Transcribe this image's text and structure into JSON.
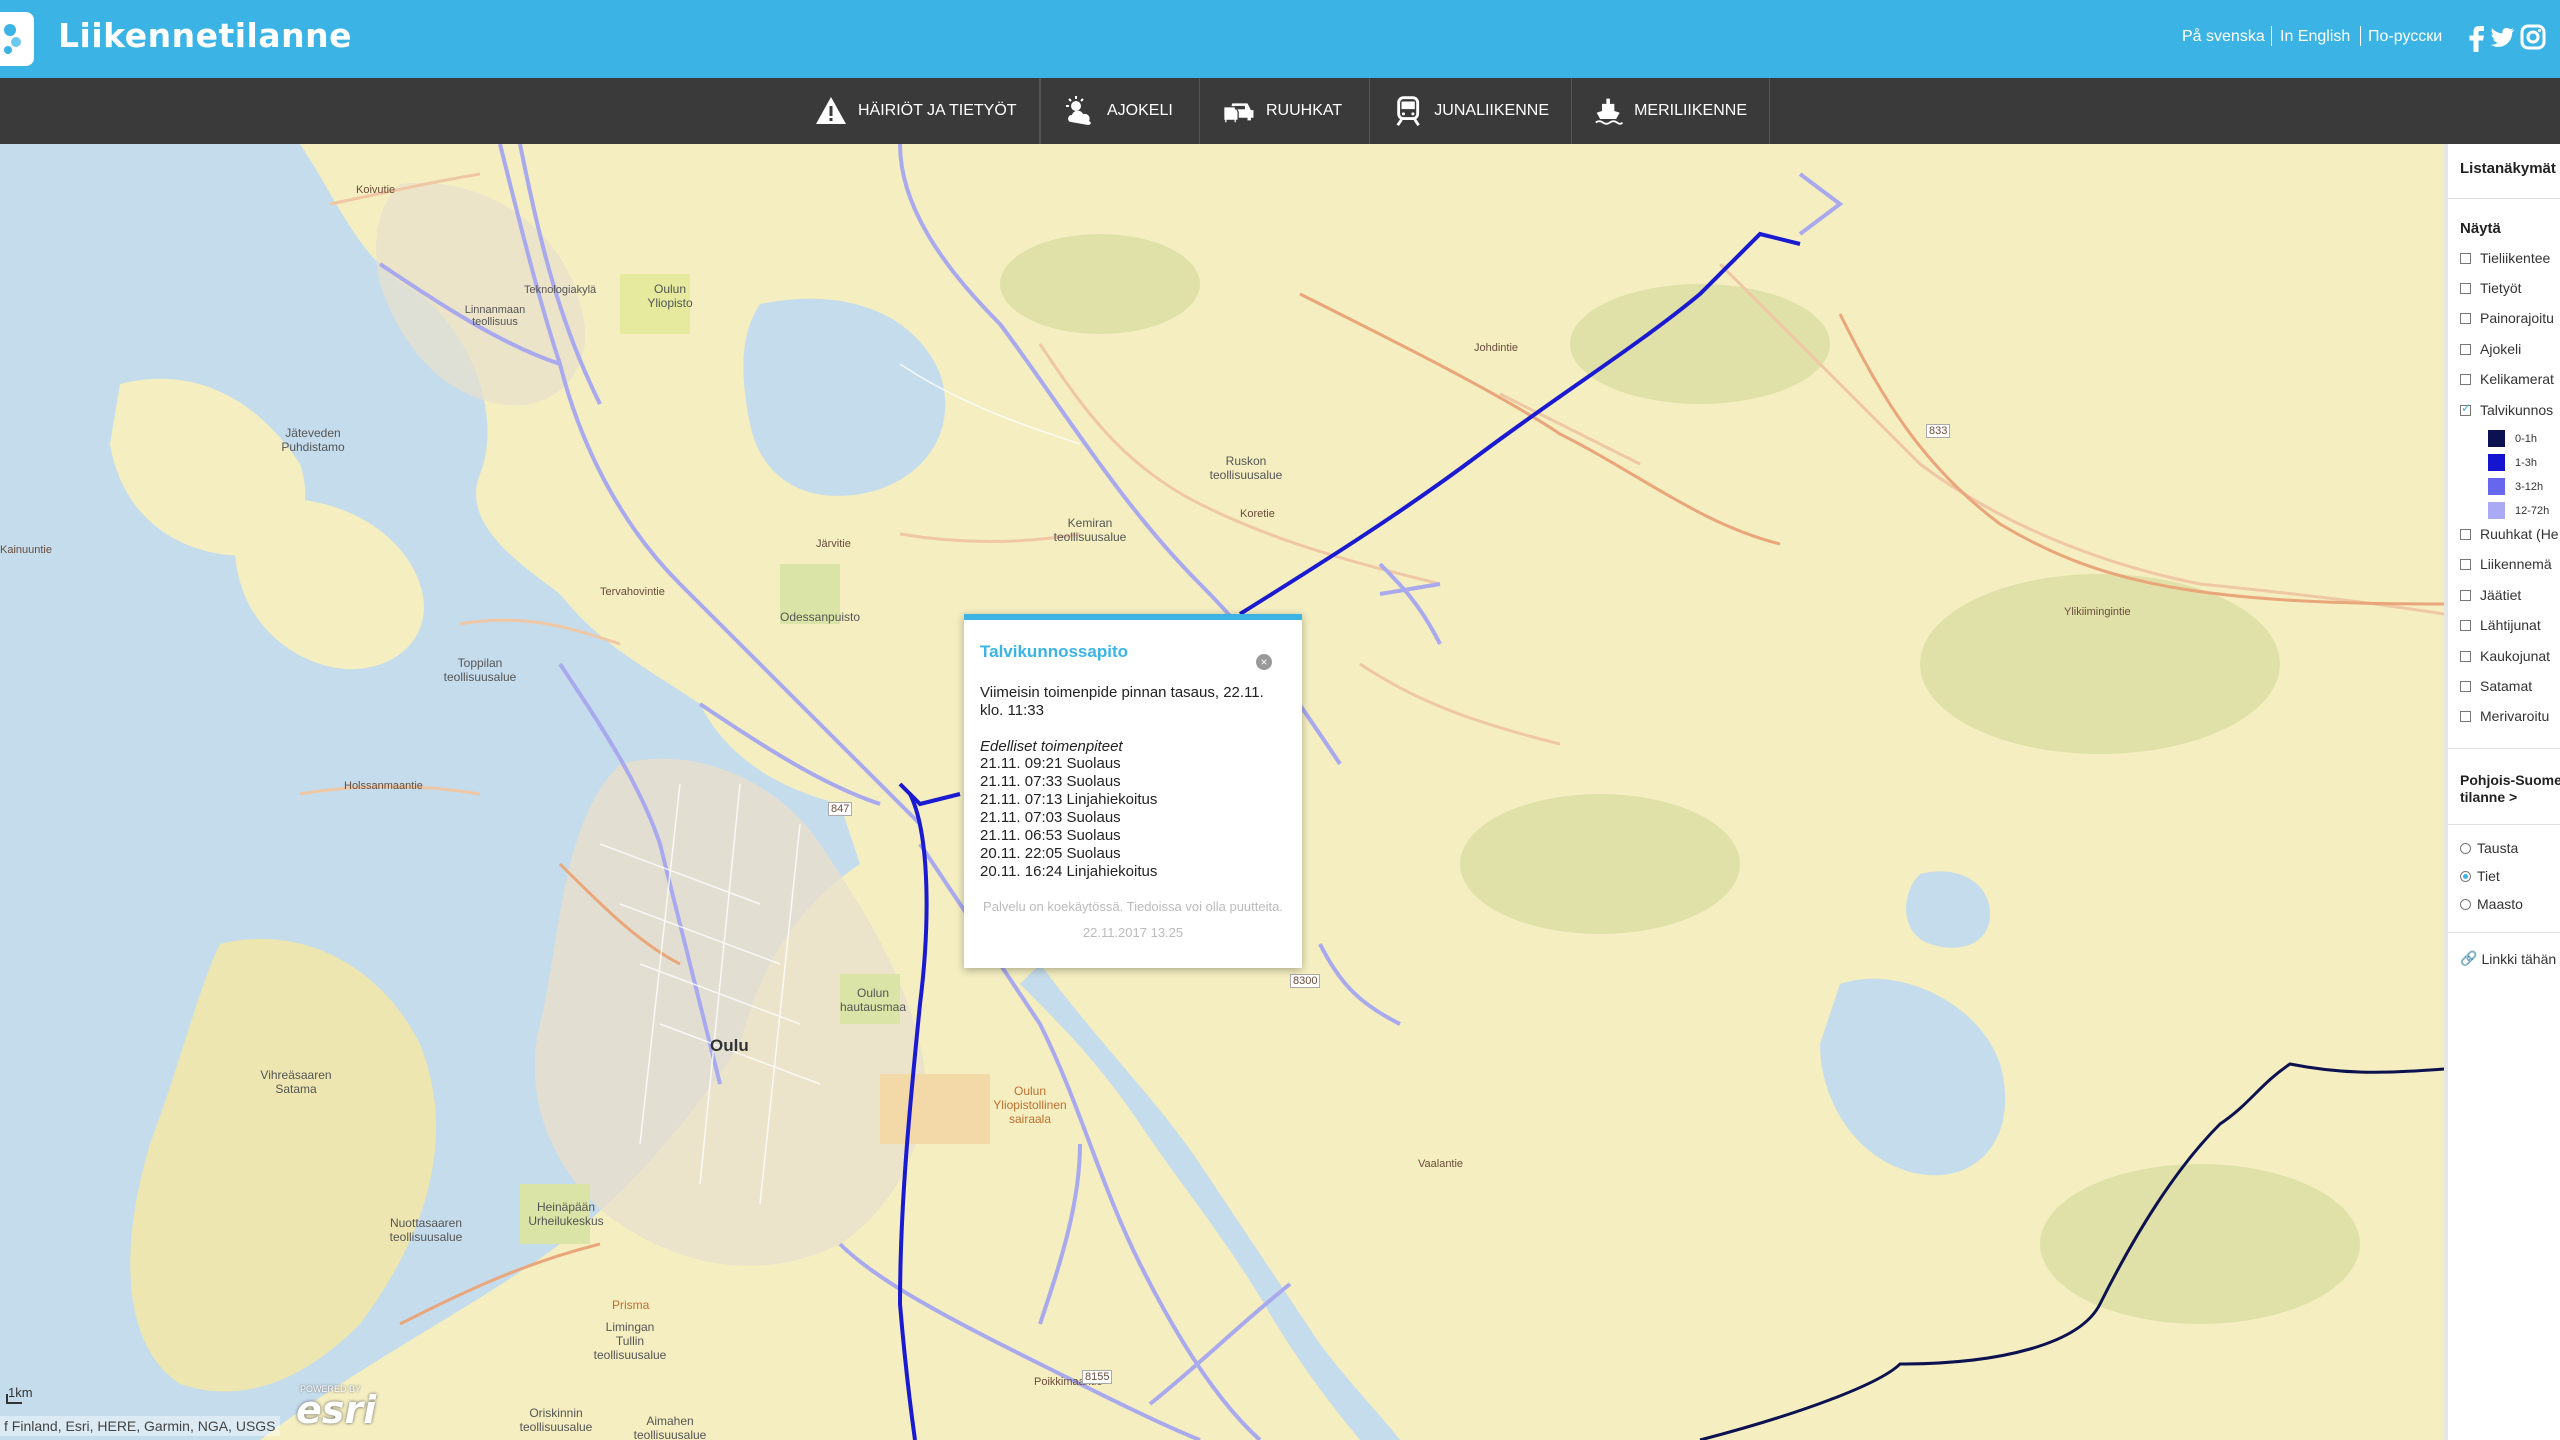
{
  "header": {
    "title": "Liikennetilanne",
    "languages": [
      "På svenska",
      "In English",
      "По-русски"
    ],
    "social": [
      "facebook-icon",
      "twitter-icon",
      "instagram-icon"
    ]
  },
  "nav": {
    "items": [
      {
        "label": "HÄIRIÖT JA TIETYÖT",
        "icon": "warning-icon"
      },
      {
        "label": "AJOKELI",
        "icon": "weather-icon"
      },
      {
        "label": "RUUHKAT",
        "icon": "cars-icon"
      },
      {
        "label": "JUNALIIKENNE",
        "icon": "train-icon"
      },
      {
        "label": "MERILIIKENNE",
        "icon": "ship-icon"
      }
    ]
  },
  "map": {
    "attribution": "f Finland, Esri, HERE, Garmin, NGA, USGS",
    "scale": "1km",
    "esri_powered": "POWERED BY",
    "esri_logo": "esri",
    "labels": {
      "koivutie": "Koivutie",
      "oulun_yliopisto": "Oulun Yliopisto",
      "linnanmaa": "Linnanmaan teollisuus",
      "teknologiakyla": "Teknologiakylä",
      "jateveden": "Jäteveden Puhdistamo",
      "ruskon": "Ruskon teollisuusalue",
      "kemiran": "Kemiran teollisuusalue",
      "odessanpuisto": "Odessanpuisto",
      "toppilan": "Toppilan teollisuusalue",
      "oulu": "Oulu",
      "oulun_hautausmaa": "Oulun hautausmaa",
      "vihreasaaren": "Vihreäsaaren Satama",
      "heinapaan": "Heinäpään Urheilukeskus",
      "nuottasaaren": "Nuottasaaren teollisuusalue",
      "limingan": "Limingan Tullin teollisuusalue",
      "orekkin": "Oriskinnin teollisuusalue",
      "aimahen": "Aimahen teollisuusalue",
      "prisma": "Prisma",
      "oulun_yliopistollinen": "Oulun Yliopistollinen sairaala",
      "koretie": "Koretie",
      "jarvitie": "Järvitie",
      "tervahovintie": "Tervahovintie",
      "holssanmaantie": "Holssanmaantie",
      "johdintie": "Johdintie",
      "kainuuntie": "Kainuuntie",
      "vaalantie": "Vaalantie",
      "poikkimaantie": "Poikkimaantie",
      "ylikiiminkiantie": "Ylikiimingintie",
      "r847": "847",
      "r833": "833",
      "r8300": "8300",
      "r8155": "8155"
    }
  },
  "popup": {
    "title": "Talvikunnossapito",
    "latest": "Viimeisin toimenpide pinnan tasaus, 22.11. klo. 11:33",
    "previous_heading": "Edelliset toimenpiteet",
    "operations": [
      "21.11. 09:21 Suolaus",
      "21.11. 07:33 Suolaus",
      "21.11. 07:13 Linjahiekoitus",
      "21.11. 07:03 Suolaus",
      "21.11. 06:53 Suolaus",
      "20.11. 22:05 Suolaus",
      "20.11. 16:24 Linjahiekoitus"
    ],
    "note": "Palvelu on koekäytössä. Tiedoissa voi olla puutteita.",
    "timestamp": "22.11.2017 13.25"
  },
  "sidebar": {
    "title": "Listanäkymät",
    "show_heading": "Näytä",
    "layers": [
      {
        "label": "Tieliikentee",
        "checked": false
      },
      {
        "label": "Tietyöt",
        "checked": false
      },
      {
        "label": "Painorajoitu",
        "checked": false
      },
      {
        "label": "Ajokeli",
        "checked": false
      },
      {
        "label": "Kelikamerat",
        "checked": false
      },
      {
        "label": "Talvikunnos",
        "checked": true
      }
    ],
    "legend": [
      {
        "label": "0-1h",
        "color": "#0c1150"
      },
      {
        "label": "1-3h",
        "color": "#1515d0"
      },
      {
        "label": "3-12h",
        "color": "#6666ee"
      },
      {
        "label": "12-72h",
        "color": "#aaaaf4"
      }
    ],
    "layers2": [
      {
        "label": "Ruuhkat (He",
        "checked": false
      },
      {
        "label": "Liikennemä",
        "checked": false
      },
      {
        "label": "Jäätiet",
        "checked": false
      },
      {
        "label": "Lähtijunat",
        "checked": false
      },
      {
        "label": "Kaukojunat",
        "checked": false
      },
      {
        "label": "Satamat",
        "checked": false
      },
      {
        "label": "Merivaroitu",
        "checked": false
      }
    ],
    "region_line1": "Pohjois-Suome",
    "region_line2": "tilanne >",
    "basemaps": [
      {
        "label": "Tausta",
        "selected": false
      },
      {
        "label": "Tiet",
        "selected": true
      },
      {
        "label": "Maasto",
        "selected": false
      }
    ],
    "link": "Linkki tähän"
  }
}
